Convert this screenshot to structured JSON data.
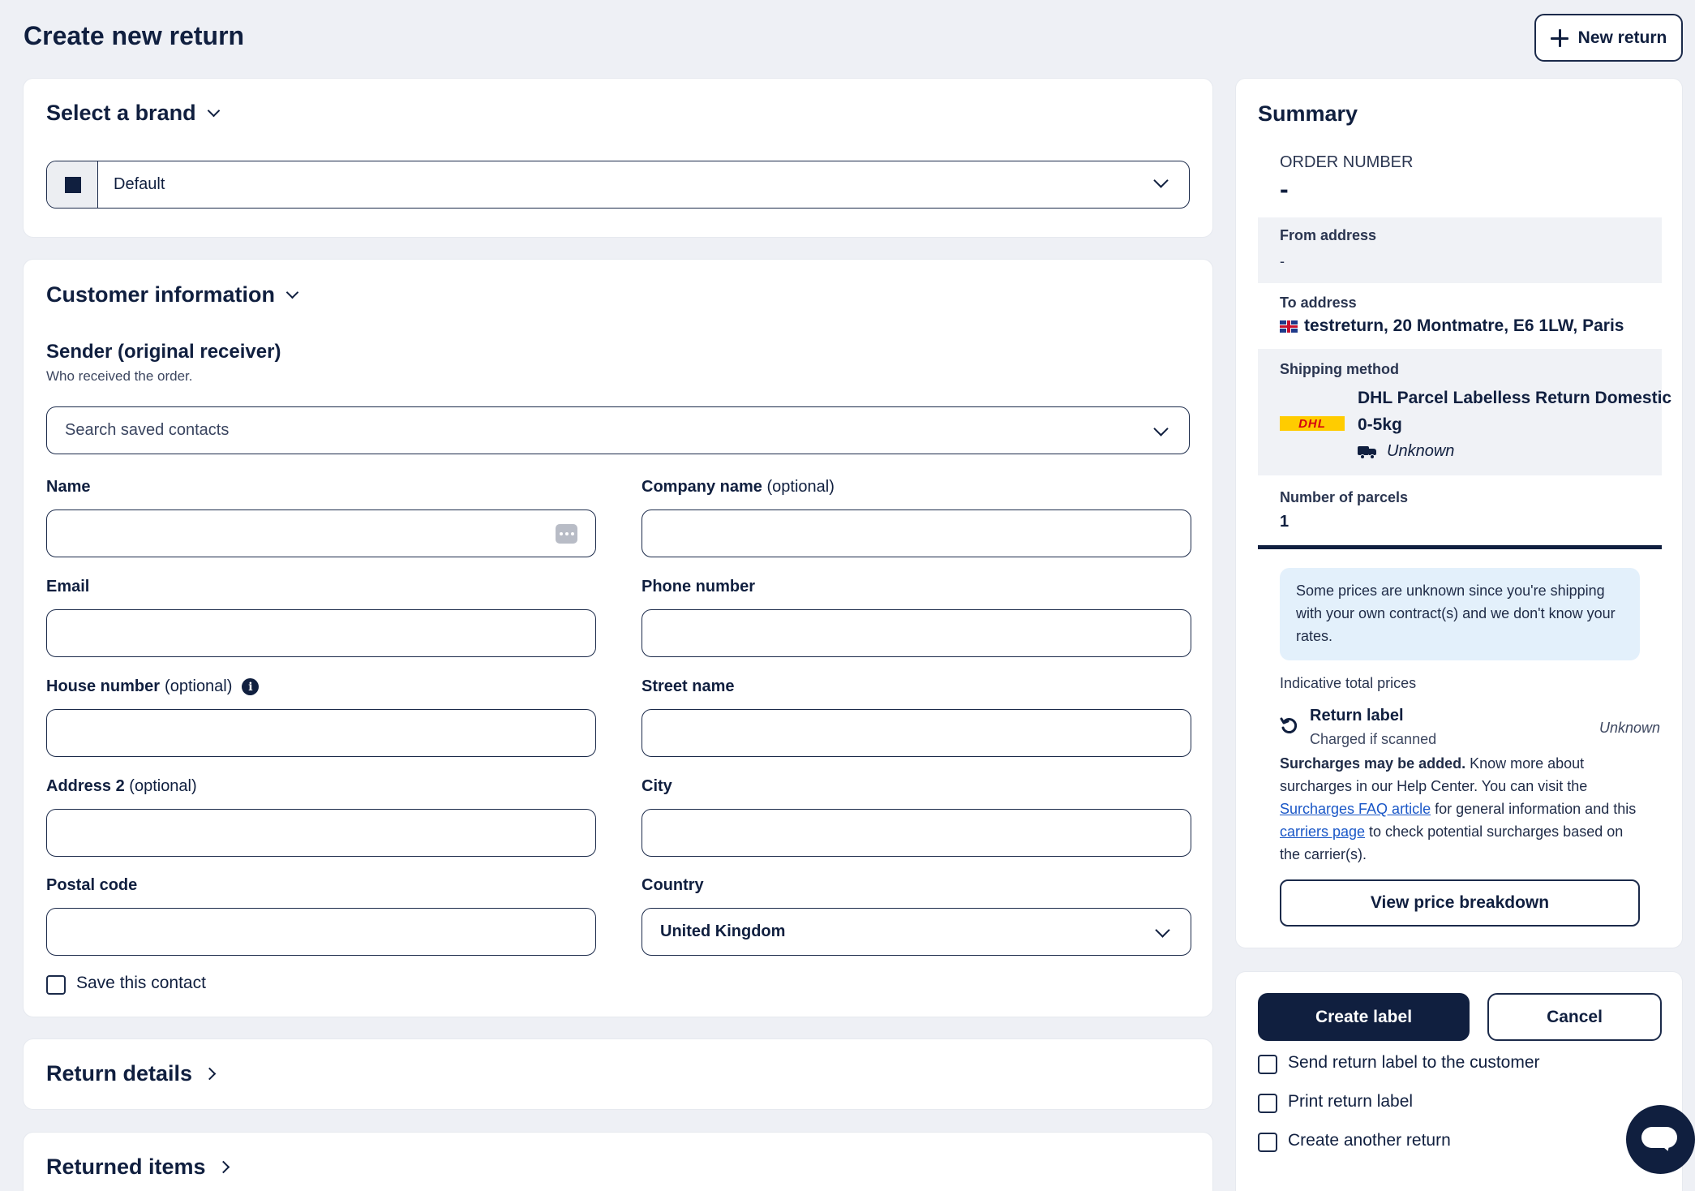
{
  "header": {
    "title": "Create new return",
    "new_return_label": "New return"
  },
  "brand": {
    "section_title": "Select a brand",
    "selected": "Default"
  },
  "customer": {
    "section_title": "Customer information",
    "sender_title": "Sender (original receiver)",
    "sender_subtitle": "Who received the order.",
    "search_placeholder": "Search saved contacts",
    "fields": {
      "name": "Name",
      "company": "Company name",
      "company_opt": "(optional)",
      "email": "Email",
      "phone": "Phone number",
      "house": "House number",
      "house_opt": "(optional)",
      "street": "Street name",
      "address2": "Address 2",
      "address2_opt": "(optional)",
      "city": "City",
      "postal": "Postal code",
      "country": "Country"
    },
    "country_value": "United Kingdom",
    "save_contact": "Save this contact"
  },
  "return_details": {
    "title": "Return details"
  },
  "returned_items": {
    "title": "Returned items"
  },
  "summary": {
    "title": "Summary",
    "order_number_label": "ORDER NUMBER",
    "order_number_value": "-",
    "from_label": "From address",
    "from_value": "-",
    "to_label": "To address",
    "to_value": "testreturn, 20 Montmatre, E6 1LW, Paris",
    "shipping_label": "Shipping method",
    "carrier_logo": "DHL",
    "shipping_name_line1": "DHL Parcel Labelless Return Domestic",
    "shipping_name_line2": "0-5kg",
    "shipping_eta": "Unknown",
    "parcels_label": "Number of parcels",
    "parcels_value": "1",
    "info_text": "Some prices are unknown since you're shipping with your own contract(s) and we don't know your rates.",
    "indicative_label": "Indicative total prices",
    "return_label_title": "Return label",
    "return_label_sub": "Charged if scanned",
    "return_label_price": "Unknown",
    "surcharge_bold": "Surcharges may be added.",
    "surcharge_text1": " Know more about surcharges in our Help Center. You can visit the ",
    "surcharge_link1": "Surcharges FAQ article",
    "surcharge_text2": " for general information and this ",
    "surcharge_link2": "carriers page",
    "surcharge_text3": " to check potential surcharges based on the carrier(s).",
    "view_breakdown": "View price breakdown"
  },
  "actions": {
    "create_label": "Create label",
    "cancel": "Cancel",
    "send_to_customer": "Send return label to the customer",
    "print_label": "Print return label",
    "create_another": "Create another return"
  },
  "colors": {
    "navy": "#101f3f",
    "background": "#eef0f5",
    "info_bg": "#e3f0fb",
    "link": "#1a57c7",
    "dhl_yellow": "#ffcc00",
    "dhl_red": "#d40511"
  }
}
